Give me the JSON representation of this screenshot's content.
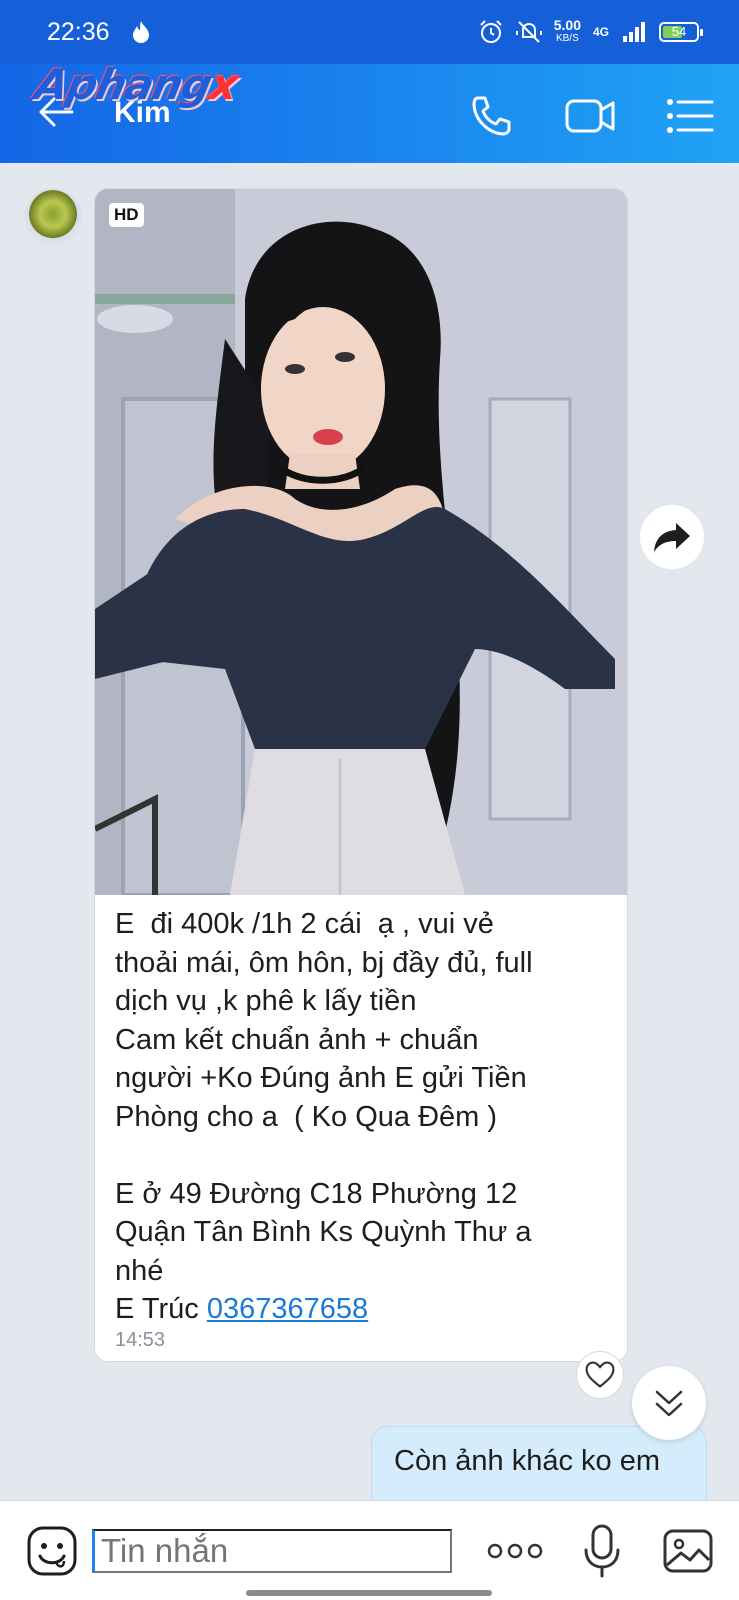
{
  "status_bar": {
    "time": "22:36",
    "speed_value": "5.00",
    "speed_unit": "KB/S",
    "network": "4G",
    "battery": "54"
  },
  "header": {
    "watermark_text": "Aphang",
    "watermark_x": "x",
    "title": "Kim"
  },
  "message_in": {
    "badge": "HD",
    "text": "E  đi 400k /1h 2 cái  ạ , vui vẻ\nthoải mái, ôm hôn, bj đầy đủ, full\ndịch vụ ,k phê k lấy tiền\nCam kết chuẩn ảnh + chuẩn\nngười +Ko Đúng ảnh E gửi Tiền\nPhòng cho a  ( Ko Qua Đêm )\n\nE ở 49 Đường C18 Phường 12\nQuận Tân Bình Ks Quỳnh Thư a\nnhé\nE Trúc ",
    "phone": "0367367658",
    "time": "14:53"
  },
  "message_out": {
    "text": "Còn ảnh khác ko em"
  },
  "input": {
    "placeholder": "Tin nhắn"
  },
  "icons": [
    "back-arrow-icon",
    "phone-icon",
    "video-icon",
    "menu-list-icon",
    "share-icon",
    "heart-icon",
    "chevron-down-double-icon",
    "emoji-icon",
    "more-dots-icon",
    "mic-icon",
    "gallery-icon"
  ],
  "colors": {
    "header_blue": "#1b8af0",
    "link_blue": "#1b7ad8",
    "outgoing_bubble": "#d4ecfb"
  }
}
